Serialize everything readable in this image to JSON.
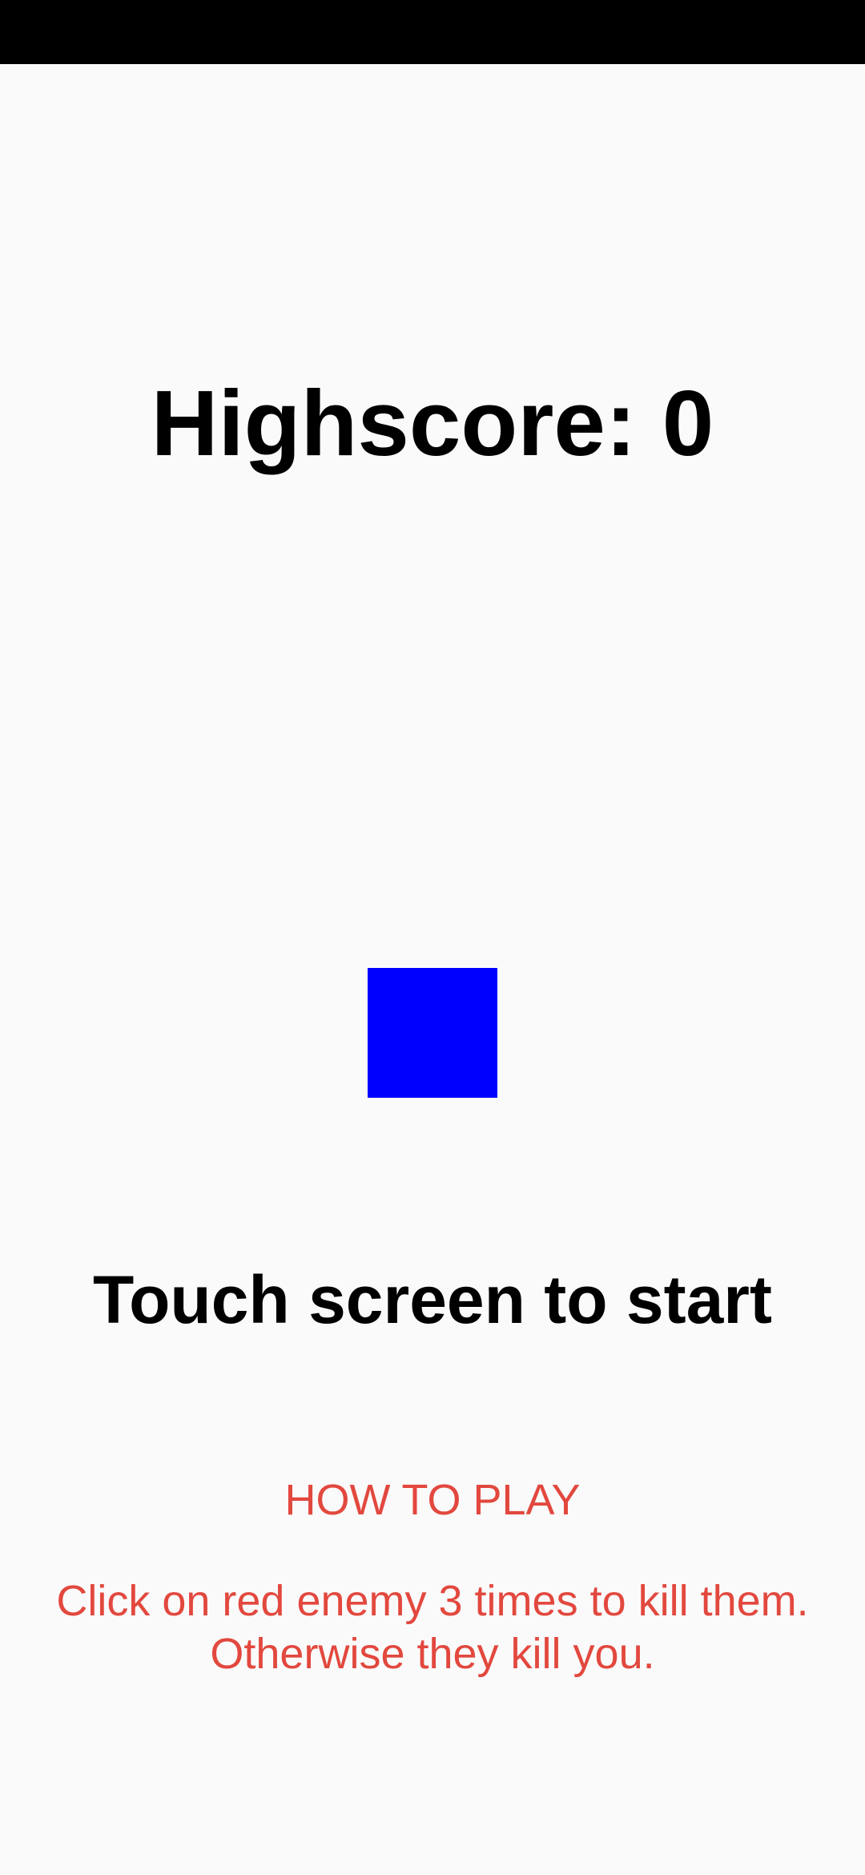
{
  "highscore": {
    "label": "Highscore:",
    "value": "0"
  },
  "player": {
    "color": "#0000ff"
  },
  "start_prompt": "Touch screen to start",
  "how_to_play": {
    "title": "HOW TO PLAY",
    "lines": [
      "Click on red enemy 3 times to kill them.",
      "Otherwise they kill you."
    ],
    "color": "#e2483e"
  }
}
